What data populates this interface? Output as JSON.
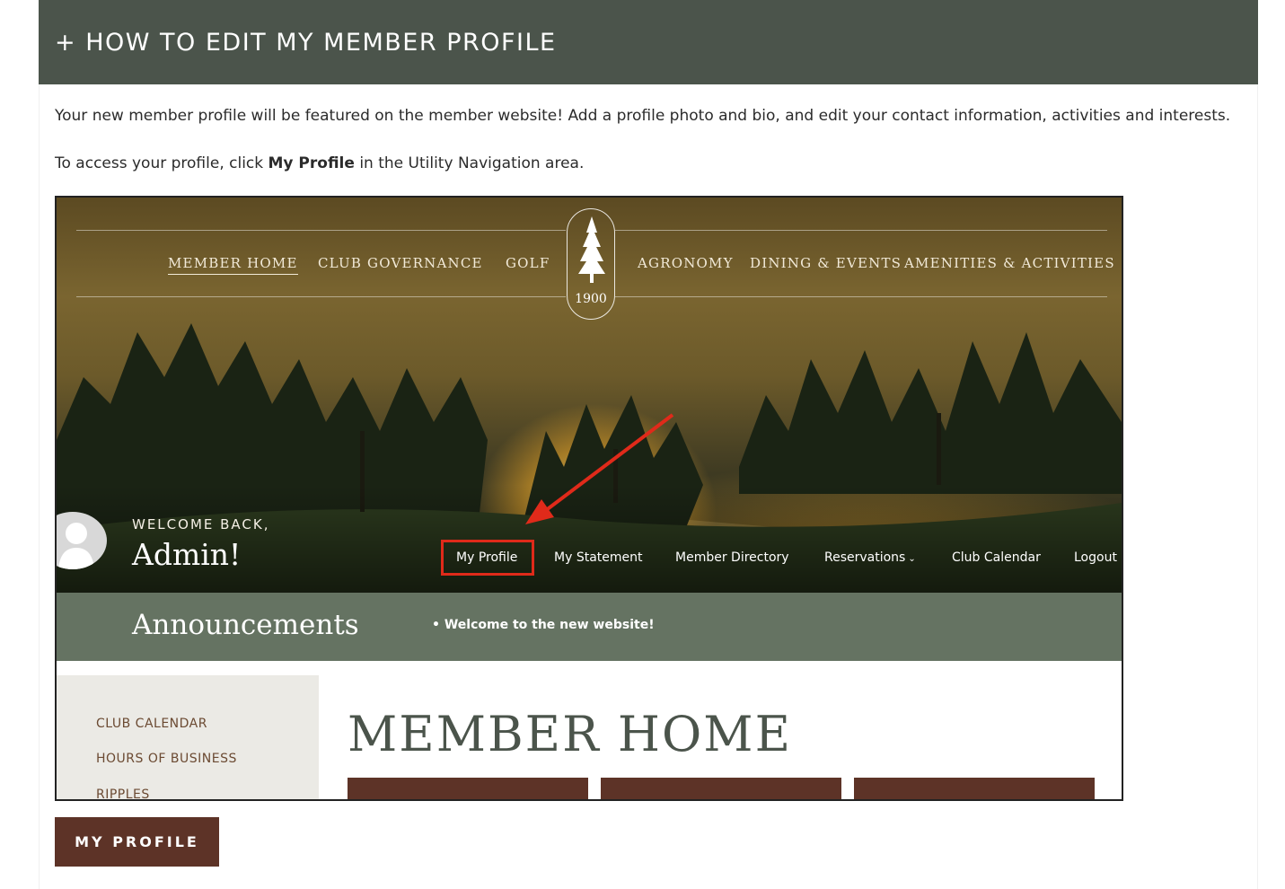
{
  "accordion": {
    "title": "+ HOW TO EDIT MY MEMBER PROFILE"
  },
  "content": {
    "intro": "Your new member profile will be featured on the member website! Add a profile photo and bio, and edit your contact information, activities and interests.",
    "access_pre": "To access your profile, click ",
    "access_bold": "My Profile",
    "access_post": " in the Utility Navigation area."
  },
  "screenshot": {
    "main_nav": [
      "MEMBER HOME",
      "CLUB GOVERNANCE",
      "GOLF",
      "AGRONOMY",
      "DINING & EVENTS",
      "AMENITIES & ACTIVITIES"
    ],
    "logo_year": "1900",
    "welcome": "WELCOME BACK,",
    "user_name": "Admin!",
    "utility_nav": {
      "my_profile": "My Profile",
      "my_statement": "My Statement",
      "member_directory": "Member Directory",
      "reservations": "Reservations",
      "club_calendar": "Club Calendar",
      "logout": "Logout"
    },
    "announcements_label": "Announcements",
    "announcement": "Welcome to the new website!",
    "sidebar": [
      "CLUB CALENDAR",
      "HOURS OF BUSINESS",
      "RIPPLES"
    ],
    "page_title": "MEMBER HOME"
  },
  "button": {
    "label": "MY PROFILE"
  },
  "colors": {
    "header_bg": "#4b544b",
    "button_bg": "#5d3327",
    "highlight": "#e02a1a",
    "announce_bg": "#657362"
  }
}
